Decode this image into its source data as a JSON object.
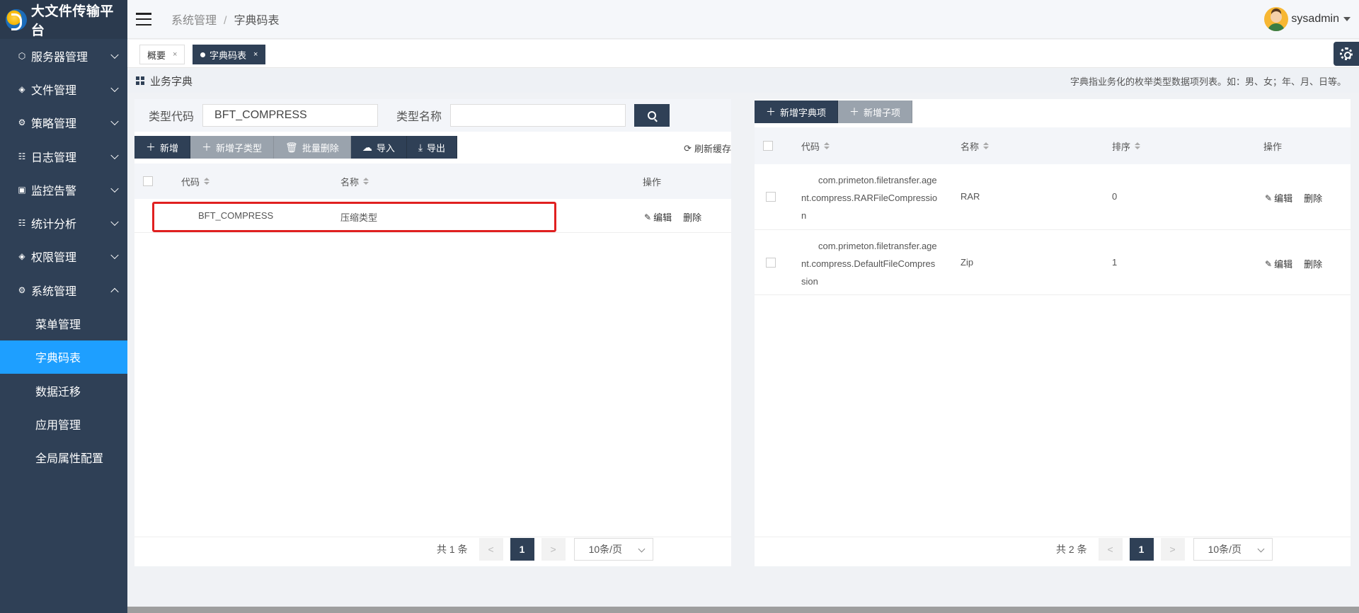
{
  "app": {
    "title": "大文件传输平台"
  },
  "sidebar": {
    "menus": [
      {
        "label": "服务器管理",
        "icon": "cube-icon"
      },
      {
        "label": "文件管理",
        "icon": "layers-icon"
      },
      {
        "label": "策略管理",
        "icon": "gear-icon"
      },
      {
        "label": "日志管理",
        "icon": "list-icon"
      },
      {
        "label": "监控告警",
        "icon": "monitor-icon"
      },
      {
        "label": "统计分析",
        "icon": "list-icon"
      },
      {
        "label": "权限管理",
        "icon": "layers-icon"
      },
      {
        "label": "系统管理",
        "icon": "gear-icon"
      }
    ],
    "submenu": [
      {
        "label": "菜单管理"
      },
      {
        "label": "字典码表"
      },
      {
        "label": "数据迁移"
      },
      {
        "label": "应用管理"
      },
      {
        "label": "全局属性配置"
      }
    ]
  },
  "header": {
    "breadcrumb_parent": "系统管理",
    "breadcrumb_sep": "/",
    "breadcrumb_current": "字典码表",
    "username": "sysadmin"
  },
  "tabs": [
    {
      "label": "概要",
      "close": "×"
    },
    {
      "label": "字典码表",
      "close": "×"
    }
  ],
  "section": {
    "title": "业务字典",
    "hint": "字典指业务化的枚举类型数据项列表。如：男、女；年、月、日等。"
  },
  "left": {
    "filter": {
      "code_label": "类型代码",
      "code_value": "BFT_COMPRESS",
      "name_label": "类型名称",
      "name_value": ""
    },
    "toolbar": {
      "add": "新增",
      "add_sub": "新增子类型",
      "batch_delete": "批量删除",
      "import": "导入",
      "export": "导出",
      "refresh": "刷新缓存"
    },
    "columns": {
      "code": "代码",
      "name": "名称",
      "action": "操作"
    },
    "rows": [
      {
        "code": "BFT_COMPRESS",
        "name": "压缩类型",
        "edit": "编辑",
        "delete": "删除"
      }
    ],
    "pager": {
      "total": "共 1 条",
      "page": "1",
      "size": "10条/页"
    }
  },
  "right": {
    "toolbar": {
      "add_item": "新增字典项",
      "add_child": "新增子项"
    },
    "columns": {
      "code": "代码",
      "name": "名称",
      "sort": "排序",
      "action": "操作"
    },
    "rows": [
      {
        "code": "com.primeton.filetransfer.agent.compress.RARFileCompression",
        "code_l1": "com.primeton.filetransfer.age",
        "code_l2": "nt.compress.RARFileCompressio",
        "code_l3": "n",
        "name": "RAR",
        "sort": "0",
        "edit": "编辑",
        "delete": "删除"
      },
      {
        "code": "com.primeton.filetransfer.agent.compress.DefaultFileCompression",
        "code_l1": "com.primeton.filetransfer.age",
        "code_l2": "nt.compress.DefaultFileCompres",
        "code_l3": "sion",
        "name": "Zip",
        "sort": "1",
        "edit": "编辑",
        "delete": "删除"
      }
    ],
    "pager": {
      "total": "共 2 条",
      "page": "1",
      "size": "10条/页"
    }
  },
  "colors": {
    "sidebar": "#2f4056",
    "active": "#1e9fff",
    "highlight": "#e02020",
    "button_gray": "#9aa3ad"
  }
}
